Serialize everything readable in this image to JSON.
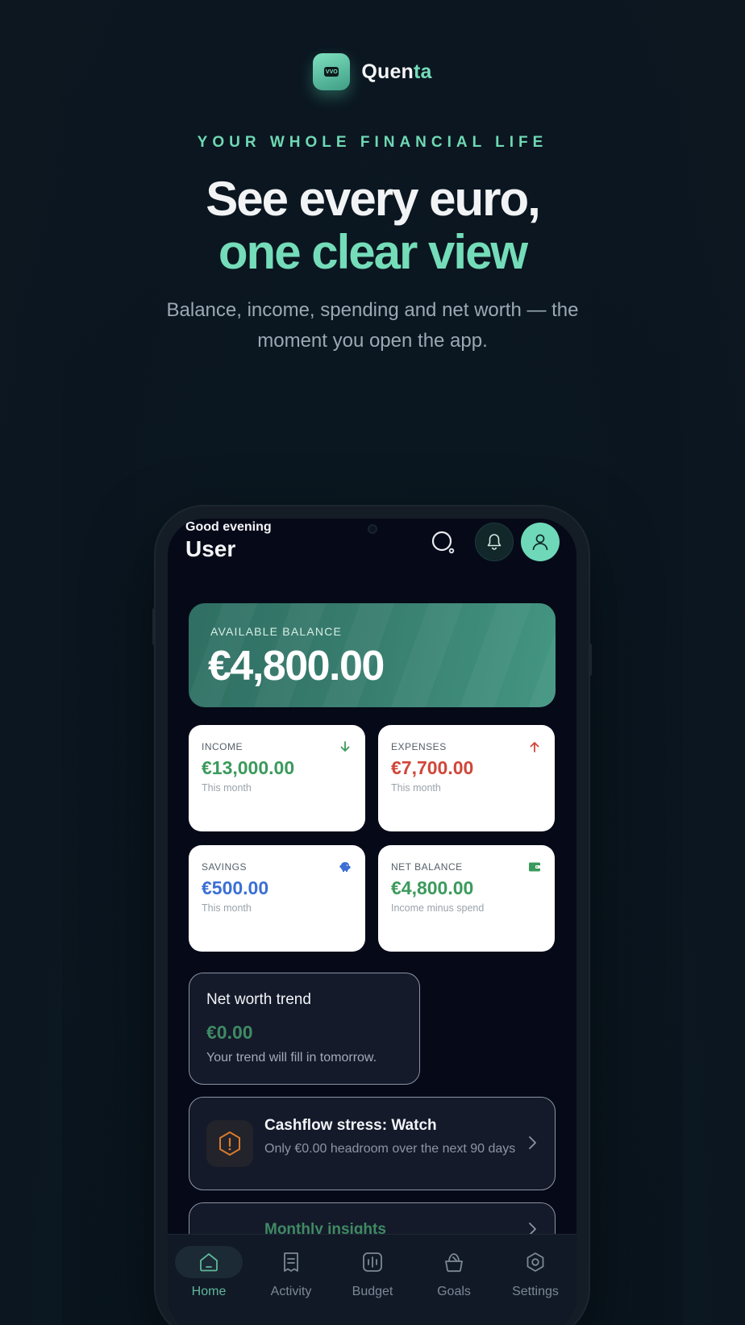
{
  "brand": {
    "name_main": "Quen",
    "name_accent": "ta",
    "logo_text": "VVO"
  },
  "hero": {
    "eyebrow": "YOUR WHOLE FINANCIAL LIFE",
    "headline_line1": "See every euro,",
    "headline_line2": "one clear view",
    "subhead": "Balance, income, spending and net worth — the moment you open the app."
  },
  "app": {
    "greeting": "Good evening",
    "user_name": "User",
    "balance": {
      "label": "AVAILABLE BALANCE",
      "value": "€4,800.00"
    },
    "stats": [
      {
        "label": "INCOME",
        "value": "€13,000.00",
        "sub": "This month",
        "color": "#3b9a5c",
        "icon": "arrow-down-icon"
      },
      {
        "label": "EXPENSES",
        "value": "€7,700.00",
        "sub": "This month",
        "color": "#d0463a",
        "icon": "arrow-up-icon"
      },
      {
        "label": "SAVINGS",
        "value": "€500.00",
        "sub": "This month",
        "color": "#3b6fd4",
        "icon": "piggy-bank-icon"
      },
      {
        "label": "NET BALANCE",
        "value": "€4,800.00",
        "sub": "Income minus spend",
        "color": "#3b9a5c",
        "icon": "wallet-icon"
      }
    ],
    "trend": {
      "title": "Net worth trend",
      "value": "€0.00",
      "sub": "Your trend will fill in tomorrow."
    },
    "stress": {
      "title": "Cashflow stress: Watch",
      "sub": "Only €0.00 headroom over the next 90 days"
    },
    "insights": {
      "title": "Monthly insights"
    },
    "tabs": [
      {
        "label": "Home",
        "icon": "home-icon",
        "active": true
      },
      {
        "label": "Activity",
        "icon": "receipt-icon",
        "active": false
      },
      {
        "label": "Budget",
        "icon": "budget-icon",
        "active": false
      },
      {
        "label": "Goals",
        "icon": "goals-icon",
        "active": false
      },
      {
        "label": "Settings",
        "icon": "settings-icon",
        "active": false
      }
    ]
  },
  "colors": {
    "accent": "#74dcb8",
    "background": "#0b1621"
  }
}
